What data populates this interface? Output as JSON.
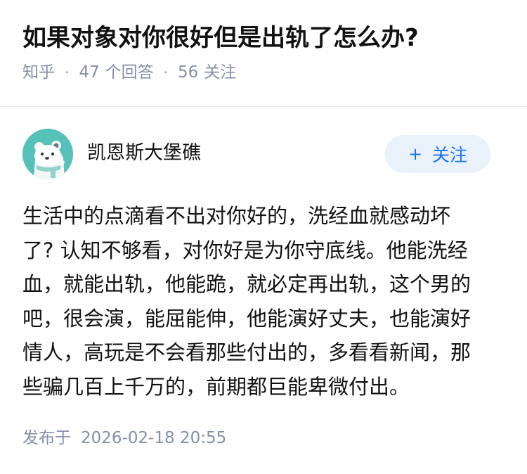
{
  "question": {
    "title": "如果对象对你很好但是出轨了怎么办?",
    "source": "知乎",
    "answers_count": "47",
    "answers_label": "个回答",
    "followers_count": "56",
    "followers_label": "关注"
  },
  "author": {
    "name": "凯恩斯大堡礁",
    "avatar_icon": "cartoon-bear-avatar",
    "avatar_color": "#55c1b8",
    "follow_label": "关注",
    "follow_icon": "plus-icon"
  },
  "answer": {
    "lines": [
      "生活中的点滴看不出对你好的，洗经血就感动坏",
      "了? 认知不够看，对你好是为你守底线。他能洗经",
      "血，就能出轨，他能跪，就必定再出轨，这个男的",
      "吧，很会演，能屈能伸，他能演好丈夫，也能演好",
      "情人，高玩是不会看那些付出的，多看看新闻，那",
      "些骗几百上千万的，前期都巨能卑微付出。"
    ]
  },
  "footer": {
    "publish_label": "发布于",
    "publish_time": "2026-02-18 20:55"
  },
  "colors": {
    "accent": "#1772f6",
    "follow_bg": "#e9f1fb",
    "meta_text": "#8590a6"
  }
}
